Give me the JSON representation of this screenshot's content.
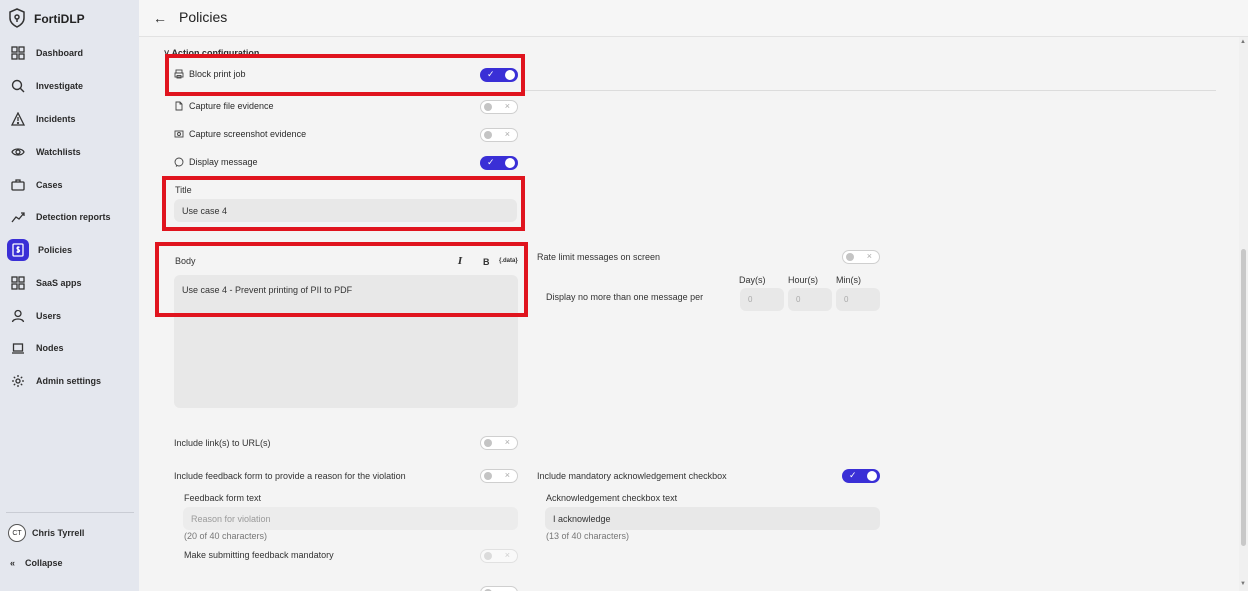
{
  "app": {
    "name": "FortiDLP"
  },
  "sidebar": {
    "items": [
      {
        "label": "Dashboard",
        "icon": "grid-icon"
      },
      {
        "label": "Investigate",
        "icon": "search-icon"
      },
      {
        "label": "Incidents",
        "icon": "warning-icon"
      },
      {
        "label": "Watchlists",
        "icon": "eye-icon"
      },
      {
        "label": "Cases",
        "icon": "briefcase-icon"
      },
      {
        "label": "Detection reports",
        "icon": "chart-line-icon"
      },
      {
        "label": "Policies",
        "icon": "policy-icon",
        "active": true
      },
      {
        "label": "SaaS apps",
        "icon": "grid-icon"
      },
      {
        "label": "Users",
        "icon": "user-icon"
      },
      {
        "label": "Nodes",
        "icon": "laptop-icon"
      },
      {
        "label": "Admin settings",
        "icon": "gear-icon"
      }
    ],
    "user": {
      "initials": "CT",
      "name": "Chris Tyrrell"
    },
    "collapse_label": "Collapse"
  },
  "header": {
    "title": "Policies"
  },
  "action_config": {
    "section_title": "Action configuration",
    "block_print": {
      "label": "Block print job",
      "on": true
    },
    "capture_file": {
      "label": "Capture file evidence",
      "on": false
    },
    "capture_screenshot": {
      "label": "Capture screenshot evidence",
      "on": false
    },
    "display_message": {
      "label": "Display message",
      "on": true
    },
    "title_field": {
      "label": "Title",
      "value": "Use case 4"
    },
    "body_field": {
      "label": "Body",
      "value": "Use case 4 - Prevent printing of PII to PDF",
      "toolbar": {
        "italic": "I",
        "bold": "B",
        "data": "{.data}"
      }
    },
    "rate_limit": {
      "label": "Rate limit messages on screen",
      "on": false,
      "display_text": "Display no more than one message per",
      "days_label": "Day(s)",
      "hours_label": "Hour(s)",
      "mins_label": "Min(s)",
      "days_placeholder": "0",
      "hours_placeholder": "0",
      "mins_placeholder": "0"
    },
    "include_links": {
      "label": "Include link(s) to URL(s)",
      "on": false
    },
    "feedback_form": {
      "label": "Include feedback form to provide a reason for the violation",
      "on": false,
      "text_label": "Feedback form text",
      "placeholder": "Reason for violation",
      "char_count": "(20 of 40 characters)",
      "mandatory_label": "Make submitting feedback mandatory"
    },
    "ack_checkbox": {
      "label": "Include mandatory acknowledgement checkbox",
      "on": true,
      "text_label": "Acknowledgement checkbox text",
      "value": "I acknowledge",
      "char_count": "(13 of 40 characters)"
    }
  },
  "colors": {
    "accent": "#3a2fd6",
    "highlight": "#e0141e"
  }
}
